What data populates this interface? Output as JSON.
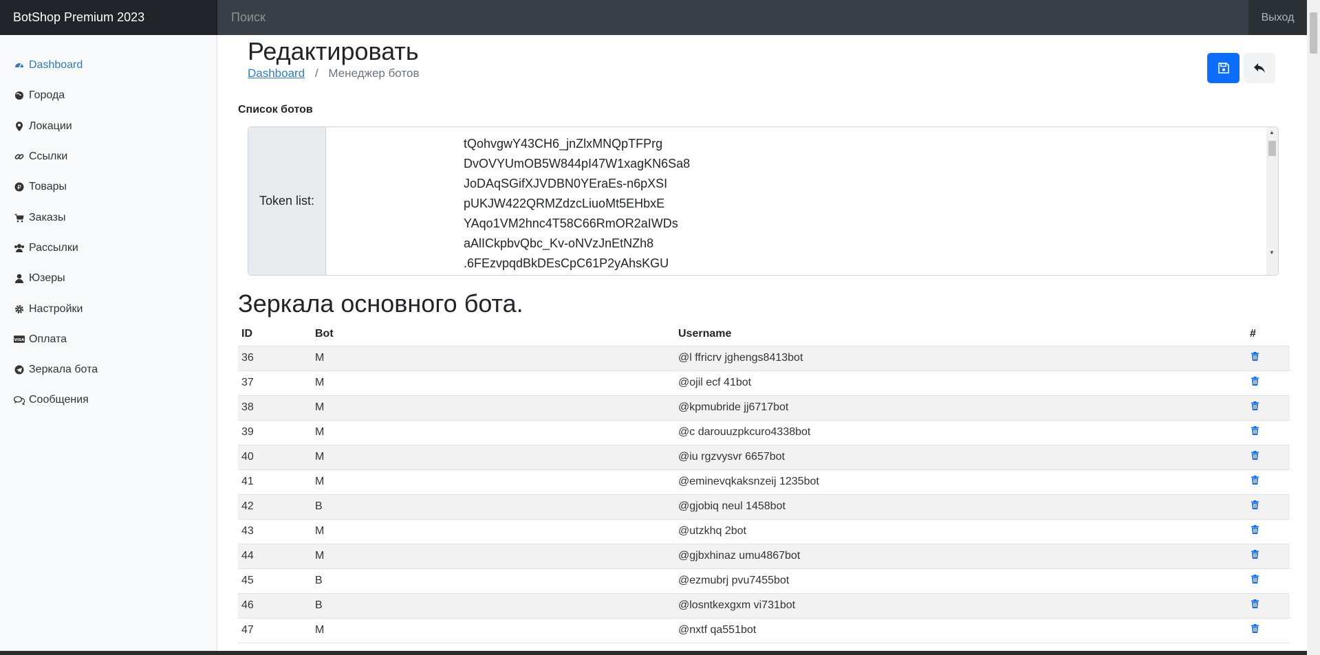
{
  "navbar": {
    "brand": "BotShop Premium 2023",
    "search_placeholder": "Поиск",
    "logout": "Выход"
  },
  "sidebar": {
    "items": [
      {
        "label": "Dashboard",
        "icon": "dashboard-icon",
        "active": true
      },
      {
        "label": "Города",
        "icon": "globe-icon"
      },
      {
        "label": "Локации",
        "icon": "map-marker-icon"
      },
      {
        "label": "Ссылки",
        "icon": "link-icon"
      },
      {
        "label": "Товары",
        "icon": "ruble-icon"
      },
      {
        "label": "Заказы",
        "icon": "cart-icon"
      },
      {
        "label": "Рассылки",
        "icon": "users-icon"
      },
      {
        "label": "Юзеры",
        "icon": "user-icon"
      },
      {
        "label": "Настройки",
        "icon": "gear-icon"
      },
      {
        "label": "Оплата",
        "icon": "visa-icon"
      },
      {
        "label": "Зеркала бота",
        "icon": "telegram-icon"
      },
      {
        "label": "Сообщения",
        "icon": "comments-icon"
      }
    ]
  },
  "header": {
    "title": "Редактировать",
    "breadcrumb": {
      "home": "Dashboard",
      "separator": "/",
      "current": "Менеджер ботов"
    }
  },
  "bots_section": {
    "label": "Список ботов",
    "token_label": "Token list:"
  },
  "tokens": [
    "tQohvgwY43CH6_jnZlxMNQpTFPrg",
    "DvOVYUmOB5W844pI47W1xagKN6Sa8",
    "JoDAqSGifXJVDBN0YEraEs-n6pXSI",
    "pUKJW422QRMZdzcLiuoMt5EHbxE",
    "YAqo1VM2hnc4T58C66RmOR2aIWDs",
    "aAlICkpbvQbc_Kv-oNVzJnEtNZh8",
    ".6FEzvpqdBkDEsCpC61P2yAhsKGU"
  ],
  "mirrors": {
    "title": "Зеркала основного бота.",
    "columns": {
      "id": "ID",
      "bot": "Bot",
      "username": "Username",
      "actions": "#"
    },
    "rows": [
      {
        "id": "36",
        "bot": "M",
        "username": "@l      ffricrv  jghengs8413bot"
      },
      {
        "id": "37",
        "bot": "M",
        "username": "@ojil        ecf     41bot"
      },
      {
        "id": "38",
        "bot": "M",
        "username": "@kpmubride        jj6717bot"
      },
      {
        "id": "39",
        "bot": "M",
        "username": "@c       darouuzpkcuro4338bot"
      },
      {
        "id": "40",
        "bot": "M",
        "username": "@iu         rgzvysvr   6657bot"
      },
      {
        "id": "41",
        "bot": "M",
        "username": "@eminevqkaksnzeij    1235bot"
      },
      {
        "id": "42",
        "bot": "B",
        "username": "@gjobiq        neul    1458bot"
      },
      {
        "id": "43",
        "bot": "M",
        "username": "@utzkhq            2bot"
      },
      {
        "id": "44",
        "bot": "M",
        "username": "@gjbxhinaz         umu4867bot"
      },
      {
        "id": "45",
        "bot": "B",
        "username": "@ezmubrj       pvu7455bot"
      },
      {
        "id": "46",
        "bot": "B",
        "username": "@losntkexgxm     vi731bot"
      },
      {
        "id": "47",
        "bot": "M",
        "username": "@nxtf           qa551bot"
      }
    ]
  },
  "colors": {
    "navbar": "#343a40",
    "accent": "#0d6efd",
    "link": "#337ab7"
  }
}
